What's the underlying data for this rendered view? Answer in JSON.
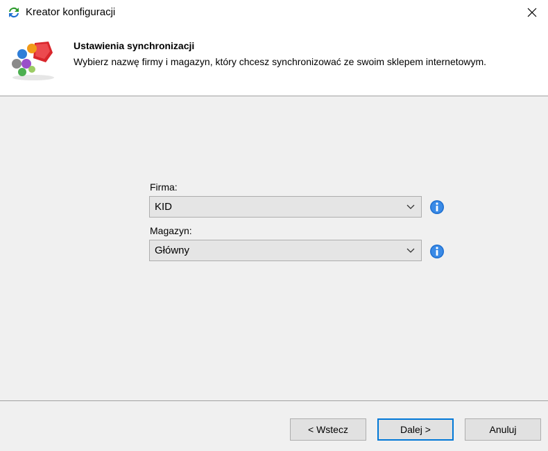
{
  "window": {
    "title": "Kreator konfiguracji"
  },
  "header": {
    "title": "Ustawienia synchronizacji",
    "description": "Wybierz nazwę firmy i magazyn, który chcesz synchronizować ze swoim sklepem internetowym."
  },
  "form": {
    "firma": {
      "label": "Firma:",
      "value": "KID"
    },
    "magazyn": {
      "label": "Magazyn:",
      "value": "Główny"
    }
  },
  "buttons": {
    "back_label": "< Wstecz",
    "next_label": "Dalej >",
    "cancel_label": "Anuluj"
  },
  "colors": {
    "content_bg": "#f0f0f0",
    "combo_bg": "#e5e5e5",
    "default_button_border": "#0078d7",
    "info_icon": "#1e6fd0"
  },
  "icons": {
    "title": "sync-arrows-icon",
    "header": "people-sync-icon",
    "close": "close-icon",
    "combo_arrow": "chevron-down-icon",
    "info": "info-icon"
  }
}
